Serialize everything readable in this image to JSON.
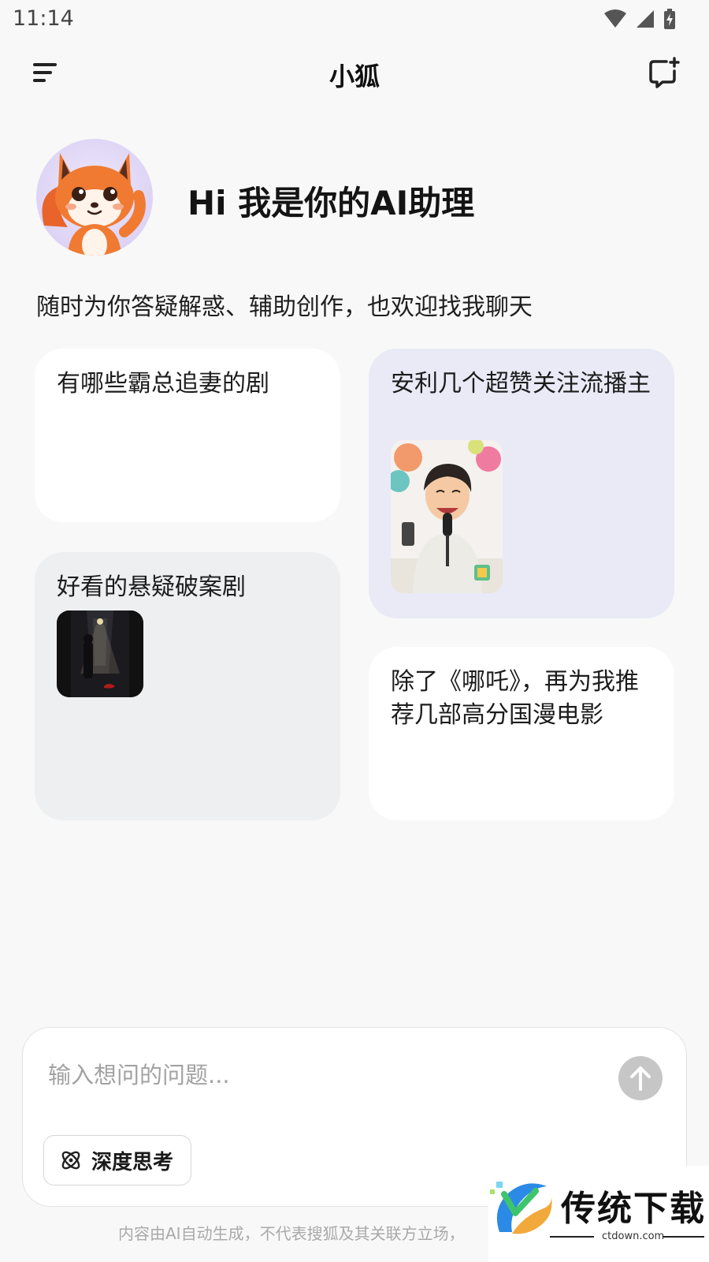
{
  "status": {
    "time": "11:14"
  },
  "appbar": {
    "title": "小狐"
  },
  "hero": {
    "greeting": "Hi 我是你的AI助理",
    "subtitle": "随时为你答疑解惑、辅助创作，也欢迎找我聊天"
  },
  "suggestions": [
    {
      "text": "有哪些霸总追妻的剧"
    },
    {
      "text": "安利几个超赞关注流播主"
    },
    {
      "text": "好看的悬疑破案剧"
    },
    {
      "text": "除了《哪吒》，再为我推荐几部高分国漫电影"
    }
  ],
  "composer": {
    "placeholder": "输入想问的问题...",
    "deep_think_label": "深度思考"
  },
  "disclaimer": "内容由AI自动生成，不代表搜狐及其关联方立场，",
  "watermark": {
    "text": "传统下载",
    "sub": "ctdown.com"
  },
  "colors": {
    "background": "#f8f8f8",
    "card_white": "#ffffff",
    "card_lavender": "#e9eaf6",
    "card_gray": "#eeeff1",
    "send_disabled": "#c6c6c6",
    "fox_orange": "#f07a32"
  }
}
